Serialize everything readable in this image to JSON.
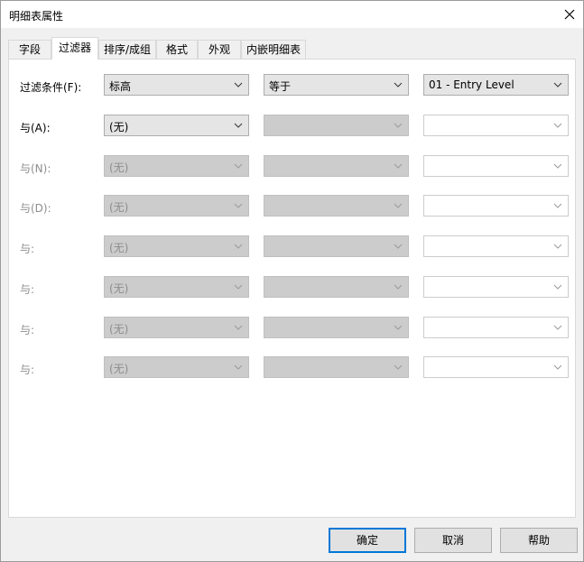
{
  "window": {
    "title": "明细表属性"
  },
  "tabs": [
    {
      "label": "字段"
    },
    {
      "label": "过滤器"
    },
    {
      "label": "排序/成组"
    },
    {
      "label": "格式"
    },
    {
      "label": "外观"
    },
    {
      "label": "内嵌明细表"
    }
  ],
  "filter_rows": [
    {
      "label": "过滤条件(F):",
      "field": "标高",
      "operator": "等于",
      "value": "01 - Entry Level"
    },
    {
      "label": "与(A):",
      "field": "(无)",
      "operator": "",
      "value": ""
    },
    {
      "label": "与(N):",
      "field": "(无)",
      "operator": "",
      "value": ""
    },
    {
      "label": "与(D):",
      "field": "(无)",
      "operator": "",
      "value": ""
    },
    {
      "label": "与:",
      "field": "(无)",
      "operator": "",
      "value": ""
    },
    {
      "label": "与:",
      "field": "(无)",
      "operator": "",
      "value": ""
    },
    {
      "label": "与:",
      "field": "(无)",
      "operator": "",
      "value": ""
    },
    {
      "label": "与:",
      "field": "(无)",
      "operator": "",
      "value": ""
    }
  ],
  "buttons": {
    "ok": "确定",
    "cancel": "取消",
    "help": "帮助"
  },
  "colors": {
    "accent": "#0078d7",
    "disabled_text": "#8d8d8d"
  }
}
